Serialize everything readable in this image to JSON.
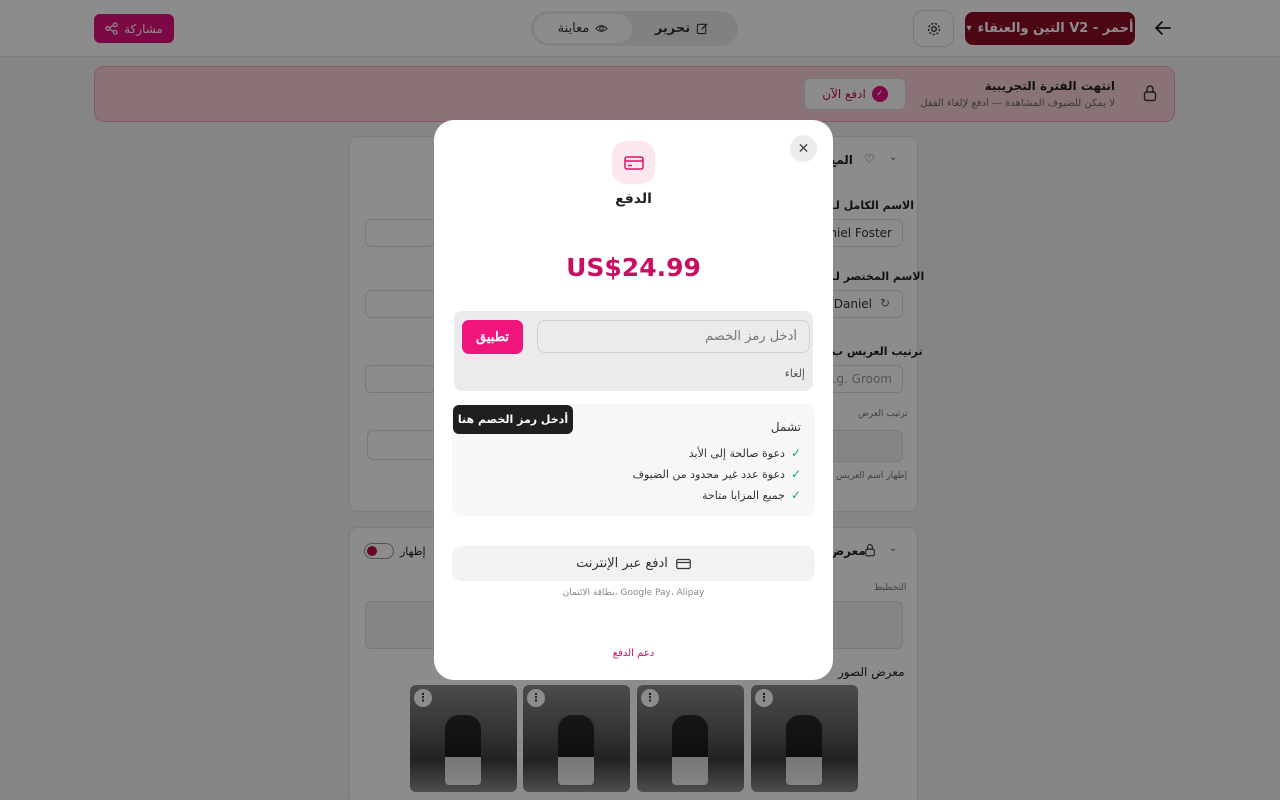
{
  "topbar": {
    "share_label": "مشاركة",
    "preview_label": "معاينة",
    "edit_label": "تحرير",
    "template_label": "التين والعنقاء V2 - أحمر"
  },
  "banner": {
    "title": "انتهت الفترة التجريبية",
    "subtitle": "لا يمكن للضيوف المشاهدة — ادفع لإلغاء القفل",
    "pay_now_label": "ادفع الآن"
  },
  "form": {
    "section1_title": "المع",
    "full_name_label": "الاسم الكامل لـ",
    "full_name_value": "aniel Foster",
    "short_name_label": "الاسم المختصر لـ",
    "short_name_value": "Daniel",
    "groom_order_label": "ترتيب العريس ب",
    "groom_order_placeholder": "e.g. Groom",
    "display_order_hint": "ترتيب العرض",
    "show_name_hint": "إظهار اسم العريس",
    "section2_title": "معرض",
    "show_label": "إظهار",
    "planning_hint": "التخطيط",
    "gallery_label": "معرض الصور"
  },
  "modal": {
    "title": "الدفع",
    "price": "US$24.99",
    "discount_placeholder": "أدخل رمز الخصم",
    "apply_label": "تطبيق",
    "cancel_label": "إلغاء",
    "tooltip": "أدخل رمز الخصم هنا",
    "includes_title": "تشمل",
    "includes": [
      "دعوة صالحة إلى الأبد",
      "دعوة عدد غير محدود من الضيوف",
      "جميع المزايا متاحة"
    ],
    "online_pay_label": "ادفع عبر الإنترنت",
    "payment_methods": "بطاقة الائتمان، Google Pay، Alipay",
    "support_label": "دعم الدفع"
  },
  "colors": {
    "brand": "#e0117a",
    "price": "#c90f62",
    "check": "#17a86b",
    "template_chip": "#8c0e25"
  }
}
